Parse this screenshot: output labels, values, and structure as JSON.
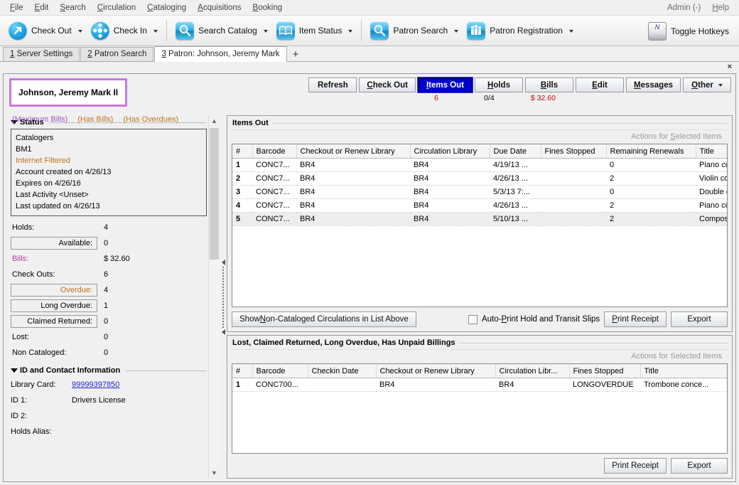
{
  "menubar": {
    "items": [
      {
        "acc": "F",
        "rest": "ile"
      },
      {
        "acc": "E",
        "rest": "dit"
      },
      {
        "acc": "S",
        "rest": "earch"
      },
      {
        "acc": "C",
        "rest": "irculation"
      },
      {
        "acc": "C",
        "rest": "ataloging"
      },
      {
        "acc": "A",
        "rest": "cquisitions"
      },
      {
        "acc": "B",
        "rest": "ooking"
      }
    ],
    "right": [
      {
        "acc": "",
        "rest": "Admin (-)"
      },
      {
        "acc": "H",
        "rest": "elp"
      }
    ]
  },
  "toolbar": {
    "buttons": [
      {
        "label": "Check Out",
        "icon": "check-out-icon",
        "caret": true
      },
      {
        "label": "Check In",
        "icon": "check-in-icon",
        "caret": true
      },
      {
        "label": "Search Catalog",
        "icon": "search-catalog-icon",
        "caret": true
      },
      {
        "label": "Item Status",
        "icon": "item-status-icon",
        "caret": true
      },
      {
        "label": "Patron Search",
        "icon": "patron-search-icon",
        "caret": true
      },
      {
        "label": "Patron Registration",
        "icon": "patron-registration-icon",
        "caret": true
      }
    ],
    "hotkeys_label": "Toggle Hotkeys",
    "hotkeys_key": "N"
  },
  "tabs": {
    "items": [
      {
        "num": "1",
        "label": " Server Settings",
        "active": false
      },
      {
        "num": "2",
        "label": " Patron Search",
        "active": false
      },
      {
        "num": "3",
        "label": " Patron: Johnson, Jeremy Mark",
        "active": true
      }
    ],
    "add_label": "+",
    "close_label": "×"
  },
  "patron": {
    "name": "Johnson, Jeremy Mark II",
    "flags": [
      {
        "text": "(Maximum Bills)",
        "color": "purple"
      },
      {
        "text": "(Has Bills)",
        "color": "orange"
      },
      {
        "text": "(Has Overdues)",
        "color": "orange"
      }
    ]
  },
  "actions": {
    "buttons": [
      {
        "acc": "",
        "pre": "Refresh",
        "post": "",
        "selected": false,
        "sub": "",
        "sub_red": false,
        "caret": false
      },
      {
        "acc": "C",
        "pre": "",
        "post": "heck Out",
        "selected": false,
        "sub": "",
        "sub_red": false,
        "caret": false
      },
      {
        "acc": "I",
        "pre": "",
        "post": "tems Out",
        "selected": true,
        "sub": "6",
        "sub_red": true,
        "caret": false
      },
      {
        "acc": "H",
        "pre": "",
        "post": "olds",
        "selected": false,
        "sub": "0/4",
        "sub_red": false,
        "caret": false
      },
      {
        "acc": "B",
        "pre": "",
        "post": "ills",
        "selected": false,
        "sub": "$ 32.60",
        "sub_red": true,
        "caret": false
      },
      {
        "acc": "E",
        "pre": "",
        "post": "dit",
        "selected": false,
        "sub": "",
        "sub_red": false,
        "caret": false
      },
      {
        "acc": "M",
        "pre": "",
        "post": "essages",
        "selected": false,
        "sub": "",
        "sub_red": false,
        "caret": false
      },
      {
        "acc": "O",
        "pre": "",
        "post": "ther",
        "selected": false,
        "sub": "",
        "sub_red": false,
        "caret": true
      }
    ]
  },
  "sidebar": {
    "status_group_title": "Status",
    "status_lines": [
      {
        "text": "Catalogers",
        "warn": false
      },
      {
        "text": "BM1",
        "warn": false
      },
      {
        "text": "Internet Filtered",
        "warn": true
      },
      {
        "text": "Account created on 4/26/13",
        "warn": false
      },
      {
        "text": "Expires on 4/26/16",
        "warn": false
      },
      {
        "text": "Last Activity <Unset>",
        "warn": false
      },
      {
        "text": "Last updated on 4/26/13",
        "warn": false
      }
    ],
    "stats": [
      {
        "label": "Holds:",
        "value": "4",
        "boxed": false,
        "color": ""
      },
      {
        "label": "Available:",
        "value": "0",
        "boxed": true,
        "color": ""
      },
      {
        "label": "Bills:",
        "value": "$ 32.60",
        "boxed": false,
        "color": "pink"
      },
      {
        "label": "Check Outs:",
        "value": "6",
        "boxed": false,
        "color": ""
      },
      {
        "label": "Overdue:",
        "value": "4",
        "boxed": true,
        "color": "orange"
      },
      {
        "label": "Long Overdue:",
        "value": "1",
        "boxed": true,
        "color": ""
      },
      {
        "label": "Claimed Returned:",
        "value": "0",
        "boxed": true,
        "color": ""
      },
      {
        "label": "Lost:",
        "value": "0",
        "boxed": false,
        "color": ""
      },
      {
        "label": "Non Cataloged:",
        "value": "0",
        "boxed": false,
        "color": ""
      }
    ],
    "id_group_title": "ID and Contact Information",
    "id_rows": [
      {
        "label": "Library Card:",
        "value": "99999397850",
        "link": true
      },
      {
        "label": "ID 1:",
        "value": "Drivers License",
        "link": false
      },
      {
        "label": "ID 2:",
        "value": "",
        "link": false
      },
      {
        "label": "Holds Alias:",
        "value": "",
        "link": false
      }
    ]
  },
  "items_out": {
    "title": "Items Out",
    "actions_label_pre": "Actions for ",
    "actions_label_acc": "S",
    "actions_label_post": "elected Items",
    "columns": [
      "#",
      "Barcode",
      "Checkout or Renew Library",
      "Circulation Library",
      "Due Date",
      "Fines Stopped",
      "Remaining Renewals",
      "Title"
    ],
    "rows": [
      {
        "num": "1",
        "barcode": "CONC7...",
        "checkout_lib": "BR4",
        "circ_lib": "BR4",
        "due": "4/19/13 ...",
        "fines_stopped": "",
        "renewals": "0",
        "title": "Piano co...",
        "selected": false
      },
      {
        "num": "2",
        "barcode": "CONC7...",
        "checkout_lib": "BR4",
        "circ_lib": "BR4",
        "due": "4/26/13 ...",
        "fines_stopped": "",
        "renewals": "2",
        "title": "Violin co...",
        "selected": false
      },
      {
        "num": "3",
        "barcode": "CONC7...",
        "checkout_lib": "BR4",
        "circ_lib": "BR4",
        "due": "5/3/13 7:...",
        "fines_stopped": "",
        "renewals": "0",
        "title": "Double c...",
        "selected": false
      },
      {
        "num": "4",
        "barcode": "CONC7...",
        "checkout_lib": "BR4",
        "circ_lib": "BR4",
        "due": "4/26/13 ...",
        "fines_stopped": "",
        "renewals": "2",
        "title": "Piano co...",
        "selected": false
      },
      {
        "num": "5",
        "barcode": "CONC7...",
        "checkout_lib": "BR4",
        "circ_lib": "BR4",
        "due": "5/10/13 ...",
        "fines_stopped": "",
        "renewals": "2",
        "title": "Composi...",
        "selected": true
      }
    ],
    "footer": {
      "show_noncat_pre": "Show ",
      "show_noncat_acc": "N",
      "show_noncat_post": "on-Cataloged Circulations in List Above",
      "autoprint_pre": "Auto-",
      "autoprint_acc": "P",
      "autoprint_post": "rint Hold and Transit Slips",
      "autoprint_checked": false,
      "print_receipt_acc": "P",
      "print_receipt_post": "rint Receipt",
      "export_label": "Export"
    }
  },
  "lost_panel": {
    "title": "Lost, Claimed Returned, Long Overdue, Has Unpaid Billings",
    "actions_label": "Actions for Selected Items",
    "columns": [
      "#",
      "Barcode",
      "Checkin Date",
      "Checkout or Renew Library",
      "Circulation Libr...",
      "Fines Stopped",
      "Title"
    ],
    "rows": [
      {
        "num": "1",
        "barcode": "CONC700...",
        "checkin_date": "",
        "checkout_lib": "BR4",
        "circ_lib": "BR4",
        "fines_stopped": "LONGOVERDUE",
        "title": "Trombone conce...",
        "selected": false
      }
    ],
    "footer": {
      "print_receipt_label": "Print Receipt",
      "export_label": "Export"
    }
  },
  "colors": {
    "accent_blue": "#0000cd",
    "purple": "#a44ec8",
    "orange": "#c3711a",
    "red": "#cc0000",
    "link": "#2222cc"
  }
}
